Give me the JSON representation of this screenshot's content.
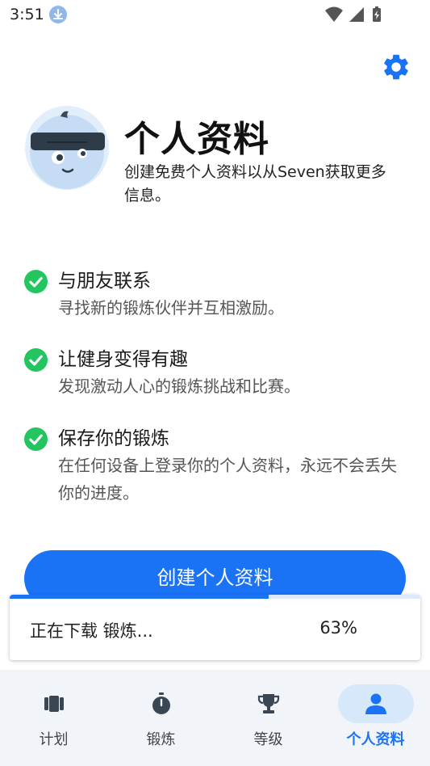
{
  "status_bar": {
    "time": "3:51",
    "icons": [
      "download-icon",
      "wifi-icon",
      "signal-icon",
      "battery-icon"
    ]
  },
  "header": {
    "settings_icon": "gear-icon",
    "accent_color": "#1a73f5"
  },
  "profile": {
    "title": "个人资料",
    "description": "创建免费个人资料以从Seven获取更多信息。",
    "avatar_icon": "mascot-avatar"
  },
  "features": [
    {
      "title": "与朋友联系",
      "description": "寻找新的锻炼伙伴并互相激励。"
    },
    {
      "title": "让健身变得有趣",
      "description": "发现激动人心的锻炼挑战和比赛。"
    },
    {
      "title": "保存你的锻炼",
      "description": "在任何设备上登录你的个人资料，永远不会丢失你的进度。"
    }
  ],
  "check_color": "#22c55e",
  "create_button": {
    "label": "创建个人资料"
  },
  "download_toast": {
    "text": "正在下载 锻炼...",
    "percent_label": "63%",
    "progress": 0.63
  },
  "bottom_nav": {
    "items": [
      {
        "label": "计划",
        "icon": "plan-icon",
        "active": false
      },
      {
        "label": "锻炼",
        "icon": "stopwatch-icon",
        "active": false
      },
      {
        "label": "等级",
        "icon": "trophy-icon",
        "active": false
      },
      {
        "label": "个人资料",
        "icon": "person-icon",
        "active": true
      }
    ]
  }
}
